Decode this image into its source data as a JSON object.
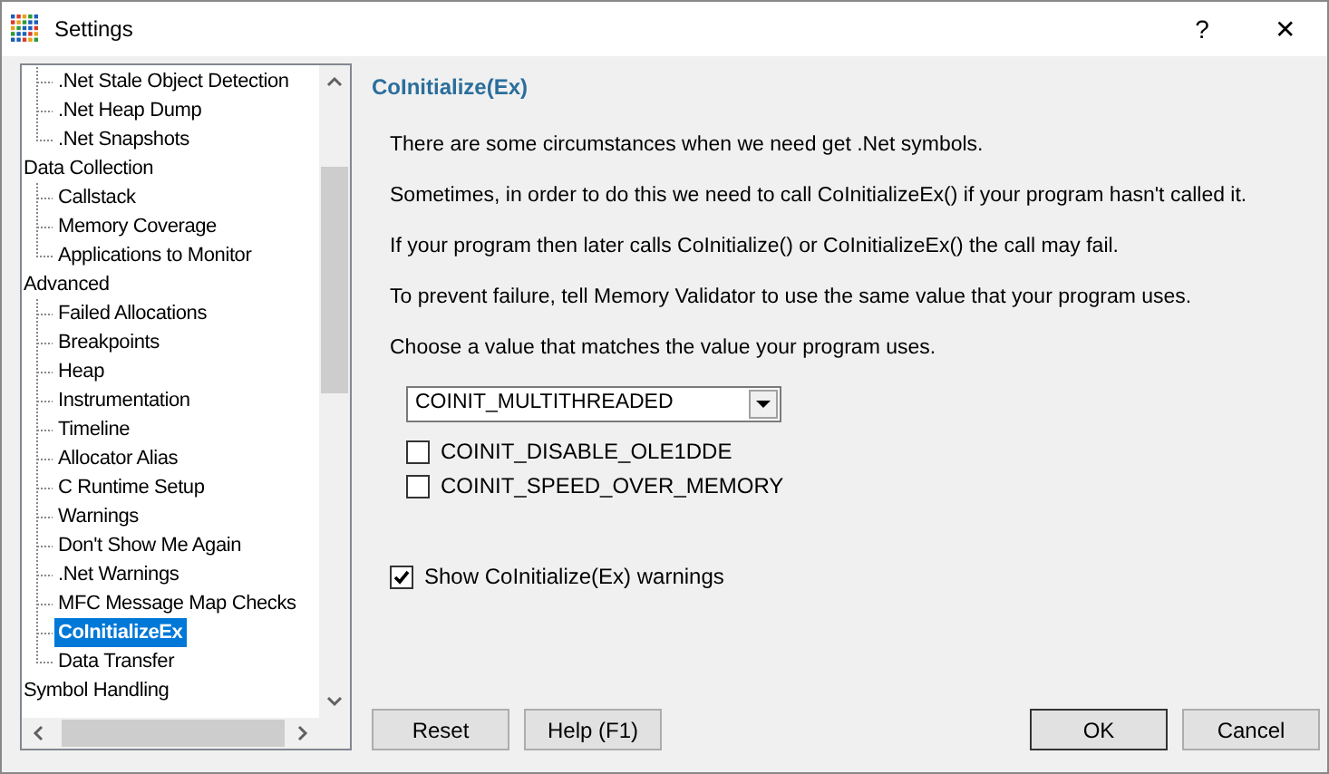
{
  "window": {
    "title": "Settings",
    "buttons": [
      "?",
      "✕"
    ]
  },
  "tree": [
    {
      "children": [
        {
          "label": ".Net Stale Object Detection",
          "selected": false
        },
        {
          "label": ".Net Heap Dump",
          "selected": false
        },
        {
          "label": ".Net Snapshots",
          "selected": false
        }
      ]
    },
    {
      "label": "Data Collection",
      "children": [
        {
          "label": "Callstack",
          "selected": false
        },
        {
          "label": "Memory Coverage",
          "selected": false
        },
        {
          "label": "Applications to Monitor",
          "selected": false
        }
      ]
    },
    {
      "label": "Advanced",
      "children": [
        {
          "label": "Failed Allocations",
          "selected": false
        },
        {
          "label": "Breakpoints",
          "selected": false
        },
        {
          "label": "Heap",
          "selected": false
        },
        {
          "label": "Instrumentation",
          "selected": false
        },
        {
          "label": "Timeline",
          "selected": false
        },
        {
          "label": "Allocator Alias",
          "selected": false
        },
        {
          "label": "C Runtime Setup",
          "selected": false
        },
        {
          "label": "Warnings",
          "selected": false
        },
        {
          "label": "Don't Show Me Again",
          "selected": false
        },
        {
          "label": ".Net Warnings",
          "selected": false
        },
        {
          "label": "MFC Message Map Checks",
          "selected": false
        },
        {
          "label": "CoInitializeEx",
          "selected": true
        },
        {
          "label": "Data Transfer",
          "selected": false
        }
      ]
    },
    {
      "label": "Symbol Handling"
    }
  ],
  "panel": {
    "heading": "CoInitialize(Ex)",
    "paragraphs": [
      "There are some circumstances when we need get .Net symbols.",
      "Sometimes, in order to do this we need to call CoInitializeEx() if your program hasn't called it.",
      "If your program then later calls CoInitialize() or CoInitializeEx() the call may fail.",
      "To prevent failure, tell Memory Validator to use the same value that your program uses.",
      "Choose a value that matches the value your program uses."
    ],
    "dropdown": {
      "value": "COINIT_MULTITHREADED"
    },
    "options": [
      {
        "label": "COINIT_DISABLE_OLE1DDE",
        "checked": false
      },
      {
        "label": "COINIT_SPEED_OVER_MEMORY",
        "checked": false
      }
    ],
    "warnings": {
      "label": "Show CoInitialize(Ex) warnings",
      "checked": true
    }
  },
  "buttons": [
    {
      "label": "Reset",
      "default": false
    },
    {
      "label": "Help (F1)",
      "default": false
    },
    {
      "label": "OK",
      "default": true
    },
    {
      "label": "Cancel",
      "default": false
    }
  ]
}
